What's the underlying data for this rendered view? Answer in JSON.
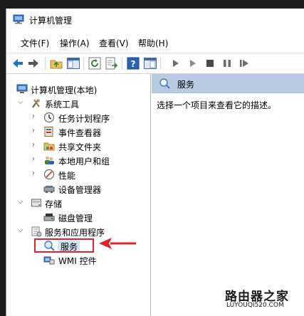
{
  "window": {
    "title": "计算机管理"
  },
  "menu": [
    {
      "label": "文件(F)",
      "name": "menu-file"
    },
    {
      "label": "操作(A)",
      "name": "menu-action"
    },
    {
      "label": "查看(V)",
      "name": "menu-view"
    },
    {
      "label": "帮助(H)",
      "name": "menu-help"
    }
  ],
  "toolbar": {
    "buttons": [
      "back-icon",
      "forward-icon",
      "up-folder-icon",
      "show-hide-tree-icon",
      "refresh-icon",
      "export-list-icon",
      "help-icon",
      "properties-icon",
      "play-icon",
      "play-outline-icon",
      "stop-icon",
      "pause-icon",
      "restart-icon"
    ]
  },
  "tree": {
    "root": "计算机管理(本地)",
    "items": [
      {
        "label": "系统工具",
        "icon": "system-tools-icon",
        "expanded": true
      },
      {
        "label": "任务计划程序",
        "icon": "task-scheduler-icon"
      },
      {
        "label": "事件查看器",
        "icon": "event-viewer-icon"
      },
      {
        "label": "共享文件夹",
        "icon": "shared-folders-icon"
      },
      {
        "label": "本地用户和组",
        "icon": "local-users-icon"
      },
      {
        "label": "性能",
        "icon": "performance-icon"
      },
      {
        "label": "设备管理器",
        "icon": "device-manager-icon"
      },
      {
        "label": "存储",
        "icon": "storage-icon",
        "expanded": true
      },
      {
        "label": "磁盘管理",
        "icon": "disk-management-icon"
      },
      {
        "label": "服务和应用程序",
        "icon": "services-apps-icon",
        "expanded": true
      },
      {
        "label": "服务",
        "icon": "services-icon",
        "selected": true
      },
      {
        "label": "WMI 控件",
        "icon": "wmi-control-icon"
      }
    ]
  },
  "right_pane": {
    "header": "服务",
    "description": "选择一个项目来查看它的描述。"
  },
  "watermark": {
    "title": "路由器之家",
    "url": "LUYOUQI520.COM"
  },
  "colors": {
    "header_bg": "#b8cbe3",
    "annotation": "#e3222a",
    "toolbar_blue": "#1a73c8"
  }
}
